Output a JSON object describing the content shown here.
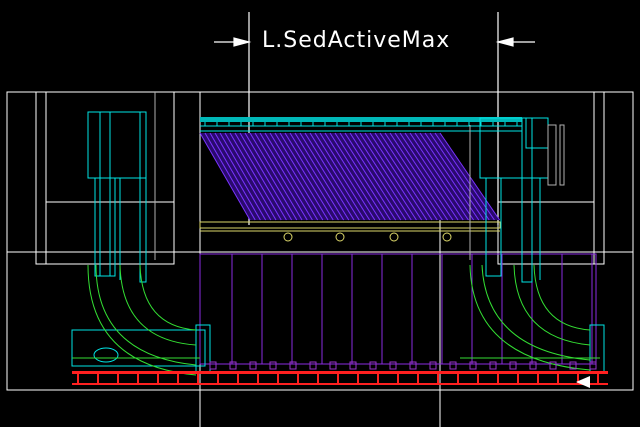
{
  "drawing": {
    "dimension_label": "L.SedActiveMax",
    "colors": {
      "background": "#000000",
      "outline": "#ffffff",
      "cyan": "#00e5e5",
      "purple": "#8a2be2",
      "violet": "#9933cc",
      "blue_fill": "#5500cc",
      "green": "#33dd33",
      "yellow": "#ddd86a",
      "red": "#ff2020",
      "grey": "#b0b0b0"
    }
  }
}
